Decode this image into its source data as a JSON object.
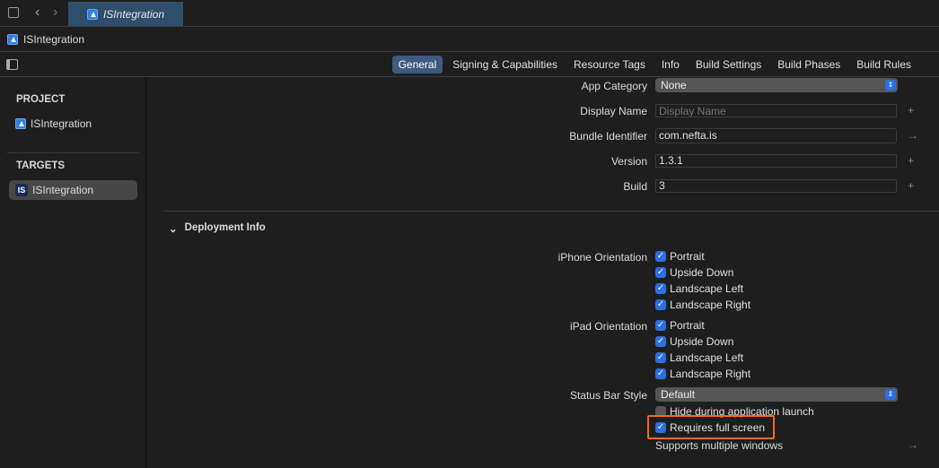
{
  "toolbar": {
    "tab_title": "ISIntegration"
  },
  "breadcrumb": {
    "project": "ISIntegration"
  },
  "tabs": [
    "General",
    "Signing & Capabilities",
    "Resource Tags",
    "Info",
    "Build Settings",
    "Build Phases",
    "Build Rules"
  ],
  "sidebar": {
    "project_header": "PROJECT",
    "project_item": "ISIntegration",
    "targets_header": "TARGETS",
    "target_item": "ISIntegration",
    "target_icon_text": "IS"
  },
  "identity": {
    "app_category_label": "App Category",
    "app_category_value": "None",
    "display_name_label": "Display Name",
    "display_name_placeholder": "Display Name",
    "bundle_id_label": "Bundle Identifier",
    "bundle_id_value": "com.nefta.is",
    "version_label": "Version",
    "version_value": "1.3.1",
    "build_label": "Build",
    "build_value": "3"
  },
  "deployment": {
    "title": "Deployment Info",
    "iphone_label": "iPhone Orientation",
    "iphone": [
      {
        "label": "Portrait",
        "checked": true
      },
      {
        "label": "Upside Down",
        "checked": true
      },
      {
        "label": "Landscape Left",
        "checked": true
      },
      {
        "label": "Landscape Right",
        "checked": true
      }
    ],
    "ipad_label": "iPad Orientation",
    "ipad": [
      {
        "label": "Portrait",
        "checked": true
      },
      {
        "label": "Upside Down",
        "checked": true
      },
      {
        "label": "Landscape Left",
        "checked": true
      },
      {
        "label": "Landscape Right",
        "checked": true
      }
    ],
    "status_bar_label": "Status Bar Style",
    "status_bar_value": "Default",
    "hide_launch": {
      "label": "Hide during application launch",
      "checked": false
    },
    "full_screen": {
      "label": "Requires full screen",
      "checked": true
    },
    "multiple_windows": "Supports multiple windows"
  },
  "colors": {
    "accent": "#2d6fe0",
    "highlight": "#f26b1d",
    "tab_active": "#2f4d6c"
  }
}
